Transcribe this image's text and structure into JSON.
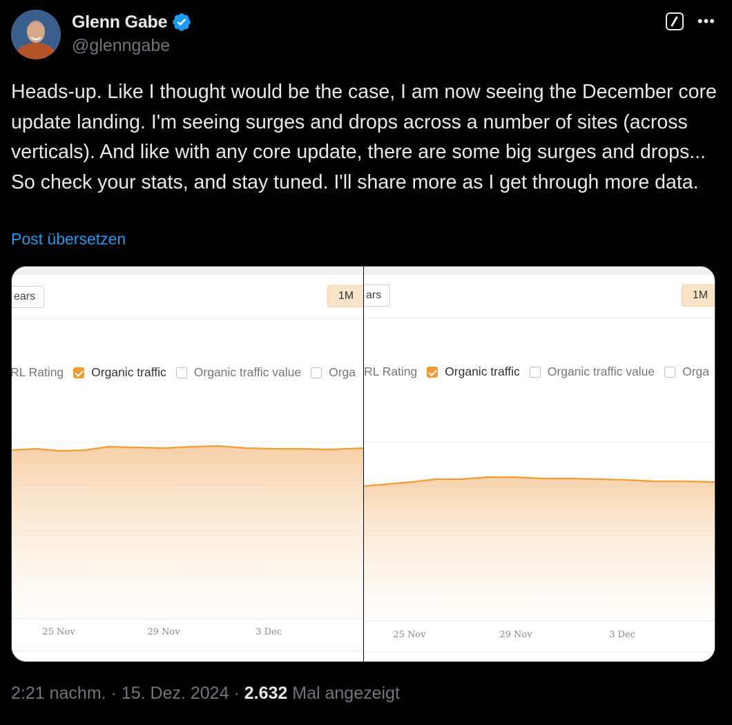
{
  "author": {
    "name": "Glenn Gabe",
    "handle": "@glenngabe",
    "verified": true,
    "avatar_icon": "avatar-photo"
  },
  "header_icons": [
    "grok-icon",
    "more-icon"
  ],
  "post": {
    "text": "Heads-up. Like I thought would be the case, I am now seeing the December core update landing. I'm seeing surges and drops across a number of sites (across verticals). And like with any core update, there are some big surges and drops... So check your stats, and stay tuned. I'll share more as I get through more data.",
    "translate_label": "Post übersetzen"
  },
  "media": {
    "panels": [
      {
        "years_btn": "ears",
        "range_btn": "1M",
        "legend": [
          {
            "label": "RL Rating",
            "checked": false,
            "partial": true
          },
          {
            "label": "Organic traffic",
            "checked": true
          },
          {
            "label": "Organic traffic value",
            "checked": false
          },
          {
            "label": "Orga",
            "checked": false
          }
        ],
        "x_ticks": [
          "25 Nov",
          "29 Nov",
          "3 Dec"
        ]
      },
      {
        "years_btn": "ars",
        "range_btn": "1M",
        "legend": [
          {
            "label": "RL Rating",
            "checked": false,
            "partial": true
          },
          {
            "label": "Organic traffic",
            "checked": true
          },
          {
            "label": "Organic traffic value",
            "checked": false
          },
          {
            "label": "Orga",
            "checked": false
          }
        ],
        "x_ticks": [
          "25 Nov",
          "29 Nov",
          "3 Dec"
        ]
      }
    ],
    "accent_color": "#f39a35"
  },
  "footer": {
    "time": "2:21 nachm.",
    "date": "15. Dez. 2024",
    "views_count": "2.632",
    "views_label": "Mal angezeigt"
  }
}
